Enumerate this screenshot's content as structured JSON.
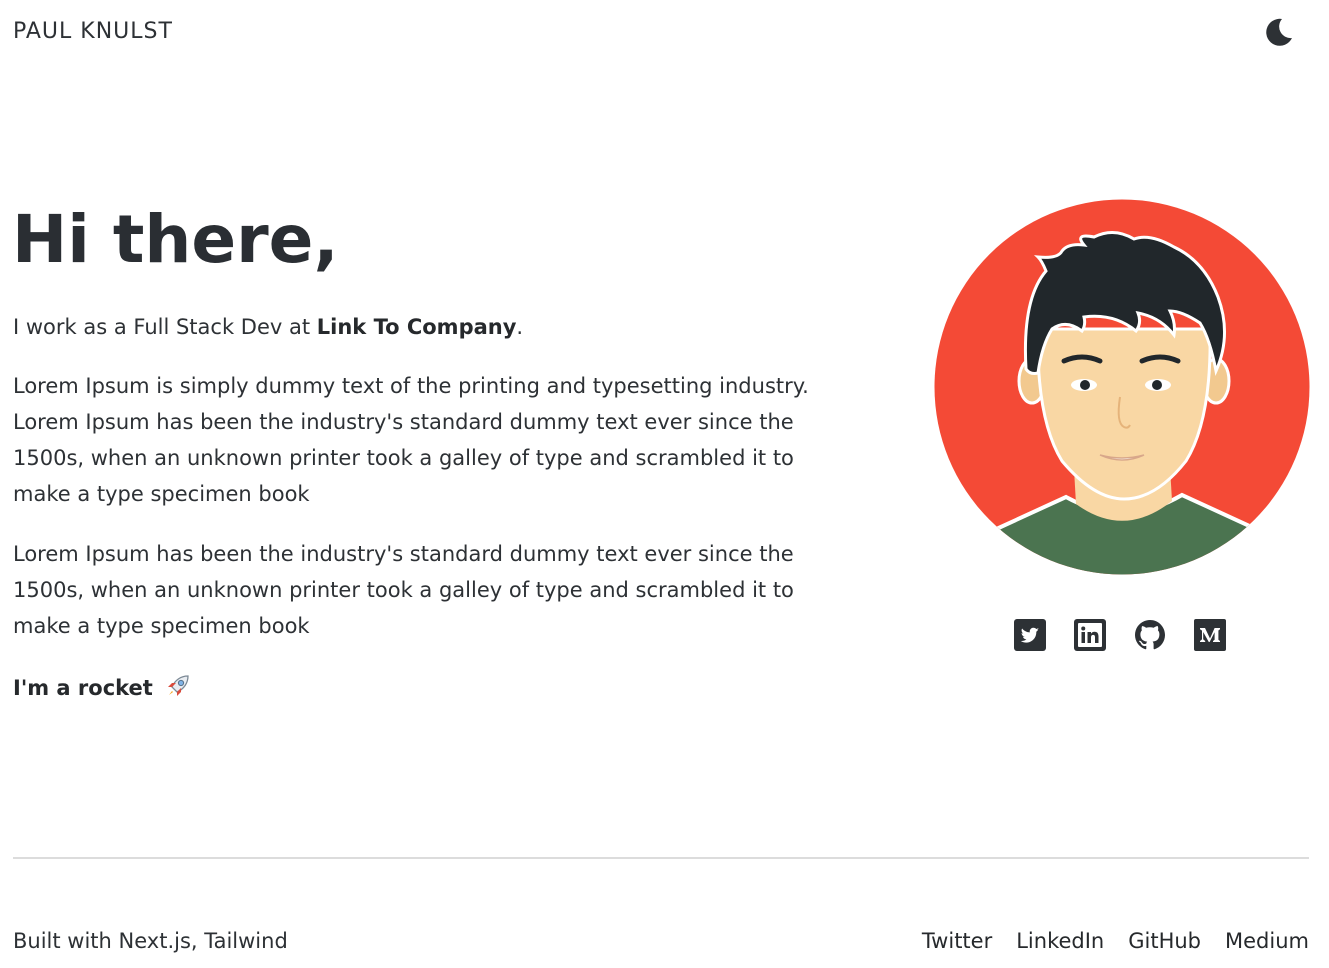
{
  "header": {
    "site_name": "PAUL KNULST",
    "theme_toggle_icon": "moon-icon"
  },
  "hero": {
    "title": "Hi there,",
    "intro_prefix": "I work as a Full Stack Dev at ",
    "company_link": "Link To Company",
    "intro_suffix": ".",
    "paragraphs": [
      "Lorem Ipsum is simply dummy text of the printing and typesetting industry. Lorem Ipsum has been the industry's standard dummy text ever since the 1500s, when an unknown printer took a galley of type and scrambled it to make a type specimen book",
      "Lorem Ipsum has been the industry's standard dummy text ever since the 1500s, when an unknown printer took a galley of type and scrambled it to make a type specimen book"
    ],
    "tagline": "I'm a rocket",
    "tagline_icon": "rocket-icon"
  },
  "avatar": {
    "icon": "avatar-illustration",
    "background_color": "#f44a36"
  },
  "social_icons": [
    {
      "name": "twitter-icon"
    },
    {
      "name": "linkedin-icon"
    },
    {
      "name": "github-icon"
    },
    {
      "name": "medium-icon"
    }
  ],
  "footer": {
    "built_with": "Built with Next.js, Tailwind",
    "links": [
      "Twitter",
      "LinkedIn",
      "GitHub",
      "Medium"
    ]
  },
  "colors": {
    "text": "#2d3135",
    "avatar_red": "#f44a36",
    "shirt_green": "#4b7450",
    "divider": "#dcdcdc"
  }
}
